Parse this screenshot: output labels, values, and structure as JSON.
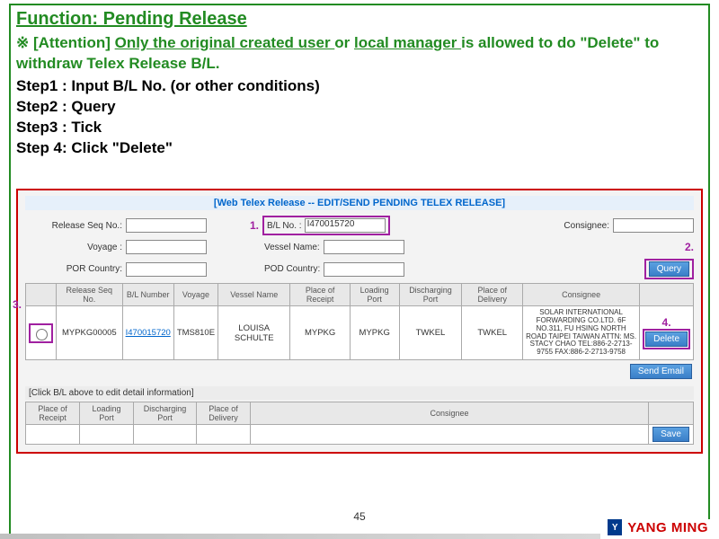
{
  "title": "Function: Pending Release",
  "attention": {
    "prefix": "※ [Attention] ",
    "part1": "Only the original created user ",
    "or": "or ",
    "part2": "local manager ",
    "rest": "is allowed to do \"Delete\" to withdraw Telex Release B/L."
  },
  "steps": {
    "s1": "Step1 : Input B/L No. (or other conditions)",
    "s2": "Step2 : Query",
    "s3": "Step3 : Tick",
    "s4": "Step 4: Click \"Delete\""
  },
  "screenshot": {
    "header": "[Web Telex Release -- EDIT/SEND PENDING TELEX RELEASE]",
    "labels": {
      "release_seq": "Release Seq No.:",
      "bl_no": "B/L No. :",
      "consignee": "Consignee:",
      "voyage": "Voyage :",
      "vessel_name": "Vessel Name:",
      "por_country": "POR Country:",
      "pod_country": "POD Country:"
    },
    "callouts": {
      "n1": "1.",
      "n2": "2.",
      "n3": "3.",
      "n4": "4."
    },
    "values": {
      "bl_no": "I470015720"
    },
    "buttons": {
      "query": "Query",
      "delete": "Delete",
      "send_email": "Send Email",
      "save": "Save"
    },
    "headers": [
      "",
      "Release Seq No.",
      "B/L Number",
      "Voyage",
      "Vessel Name",
      "Place of Receipt",
      "Loading Port",
      "Discharging Port",
      "Place of Delivery",
      "Consignee",
      ""
    ],
    "row": {
      "seq": "MYPKG00005",
      "bl": "I470015720",
      "voyage": "TMS810E",
      "vessel": "LOUISA SCHULTE",
      "por": "MYPKG",
      "pol": "MYPKG",
      "pod": "TWKEL",
      "del": "TWKEL",
      "consignee": "SOLAR INTERNATIONAL FORWARDING CO.LTD. 6F NO.311, FU HSING NORTH ROAD TAIPEI TAIWAN ATTN: MS. STACY CHAO TEL:886-2-2713-9755 FAX:886-2-2713-9758"
    },
    "hint": "[Click B/L above to edit detail information]",
    "bottom_headers": [
      "Place of Receipt",
      "Loading Port",
      "Discharging Port",
      "Place of Delivery",
      "Consignee",
      ""
    ]
  },
  "page": "45",
  "brand": {
    "logo": "Y",
    "name": "YANG MING"
  }
}
